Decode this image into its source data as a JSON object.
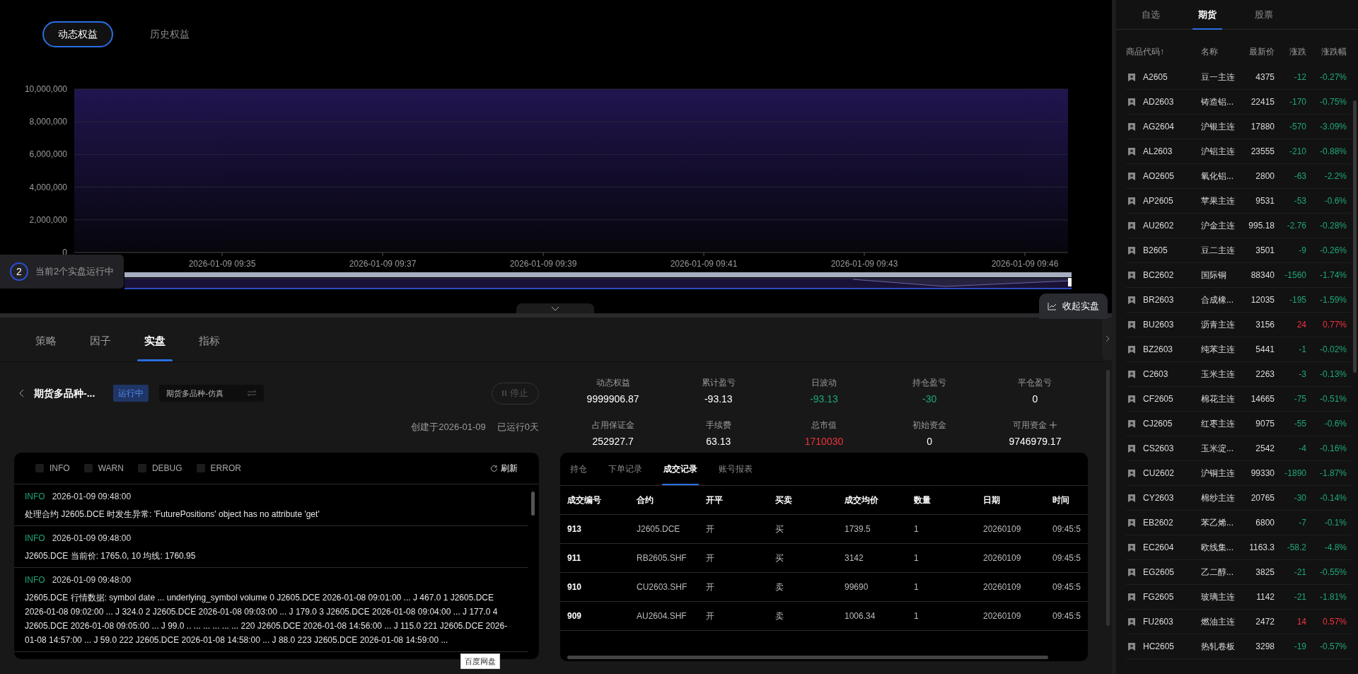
{
  "chart_tabs": [
    {
      "label": "动态权益",
      "selected": true
    },
    {
      "label": "历史权益",
      "selected": false
    }
  ],
  "equity_chart": {
    "chart_data": {
      "type": "area",
      "categories": [
        "2026-01-09 09:35",
        "2026-01-09 09:37",
        "2026-01-09 09:39",
        "2026-01-09 09:41",
        "2026-01-09 09:43",
        "2026-01-09 09:46"
      ],
      "grid": true,
      "series": [
        {
          "color": "#4a2fb0",
          "values": [
            10000000,
            10000000,
            10000000,
            10000000,
            10000000,
            10000000
          ]
        }
      ],
      "ylim": [
        0,
        10000000
      ],
      "yticks": [
        {
          "value": 0,
          "label": "0"
        },
        {
          "value": 2000000,
          "label": "2,000,000"
        },
        {
          "value": 4000000,
          "label": "4,000,000"
        },
        {
          "value": 6000000,
          "label": "6,000,000"
        },
        {
          "value": 8000000,
          "label": "8,000,000"
        },
        {
          "value": 10000000,
          "label": "10,000,000"
        }
      ]
    }
  },
  "zoom_slider": {
    "level": 1
  },
  "running_badge": {
    "count": "2",
    "label": "当前2个实盘运行中"
  },
  "collapse_button": "收起实盘",
  "bottom_tabs": [
    {
      "label": "策略",
      "selected": false
    },
    {
      "label": "因子",
      "selected": false
    },
    {
      "label": "实盘",
      "selected": true
    },
    {
      "label": "指标",
      "selected": false
    }
  ],
  "strategy": {
    "name": "期货多品种-...",
    "status": "运行中",
    "account": "期货多品种-仿真",
    "stop_button": {
      "label": "停止",
      "disabled": true
    },
    "created": "创建于2026-01-09",
    "running_days": "已运行0天"
  },
  "metrics": [
    {
      "label": "动态权益",
      "value": "9999906.87",
      "color": "#ffffff",
      "addable": false
    },
    {
      "label": "累计盈亏",
      "value": "-93.13",
      "color": "#ffffff",
      "addable": false
    },
    {
      "label": "日波动",
      "value": "-93.13",
      "color": "#1fa67a",
      "addable": false
    },
    {
      "label": "持仓盈亏",
      "value": "-30",
      "color": "#1fa67a",
      "addable": false
    },
    {
      "label": "平仓盈亏",
      "value": "0",
      "color": "#ffffff",
      "addable": false
    },
    {
      "label": "占用保证金",
      "value": "252927.7",
      "color": "#ffffff",
      "addable": false
    },
    {
      "label": "手续费",
      "value": "63.13",
      "color": "#ffffff",
      "addable": false
    },
    {
      "label": "总市值",
      "value": "1710030",
      "color": "#f2323f",
      "addable": false
    },
    {
      "label": "初始资金",
      "value": "0",
      "color": "#ffffff",
      "addable": false
    },
    {
      "label": "可用资金",
      "value": "9746979.17",
      "color": "#ffffff",
      "addable": true
    }
  ],
  "log": {
    "filters": [
      {
        "label": "INFO",
        "checked": false
      },
      {
        "label": "WARN",
        "checked": false
      },
      {
        "label": "DEBUG",
        "checked": false
      },
      {
        "label": "ERROR",
        "checked": false
      }
    ],
    "refresh": "刷新",
    "entries": [
      {
        "level": "INFO",
        "time": "2026-01-09 09:48:00",
        "message": "处理合约 J2605.DCE 时发生异常: 'FuturePositions' object has no attribute 'get'"
      },
      {
        "level": "INFO",
        "time": "2026-01-09 09:48:00",
        "message": "J2605.DCE 当前价: 1765.0, 10 均线: 1760.95"
      },
      {
        "level": "INFO",
        "time": "2026-01-09 09:48:00",
        "message": "J2605.DCE 行情数据: symbol date ... underlying_symbol volume 0 J2605.DCE 2026-01-08 09:01:00 ... J 467.0 1 J2605.DCE 2026-01-08 09:02:00 ... J 324.0 2 J2605.DCE 2026-01-08 09:03:00 ... J 179.0 3 J2605.DCE 2026-01-08 09:04:00 ... J 177.0 4 J2605.DCE 2026-01-08 09:05:00 ... J 99.0 .. ... ... ... ... ... 220 J2605.DCE 2026-01-08 14:56:00 ... J 115.0 221 J2605.DCE 2026-01-08 14:57:00 ... J 59.0 222 J2605.DCE 2026-01-08 14:58:00 ... J 88.0 223 J2605.DCE 2026-01-08 14:59:00 ..."
      }
    ]
  },
  "tooltip": "百度网盘",
  "trades": {
    "tabs": [
      {
        "label": "持仓",
        "selected": false
      },
      {
        "label": "下单记录",
        "selected": false
      },
      {
        "label": "成交记录",
        "selected": true
      },
      {
        "label": "账号报表",
        "selected": false
      }
    ],
    "columns": [
      "成交编号",
      "合约",
      "开平",
      "买卖",
      "成交均价",
      "数量",
      "日期",
      "时间"
    ],
    "rows": [
      [
        "913",
        "J2605.DCE",
        "开",
        "买",
        "1739.5",
        "1",
        "20260109",
        "09:45:5"
      ],
      [
        "911",
        "RB2605.SHF",
        "开",
        "买",
        "3142",
        "1",
        "20260109",
        "09:45:5"
      ],
      [
        "910",
        "CU2603.SHF",
        "开",
        "卖",
        "99690",
        "1",
        "20260109",
        "09:45:5"
      ],
      [
        "909",
        "AU2604.SHF",
        "开",
        "卖",
        "1006.34",
        "1",
        "20260109",
        "09:45:5"
      ]
    ]
  },
  "quotes": {
    "tabs": [
      {
        "label": "自选",
        "selected": false
      },
      {
        "label": "期货",
        "selected": true
      },
      {
        "label": "股票",
        "selected": false
      }
    ],
    "columns": [
      "商品代码↑",
      "名称",
      "最新价",
      "涨跌",
      "涨跌幅"
    ],
    "rows": [
      {
        "code": "A2605",
        "name": "豆一主连",
        "price": "4375",
        "change": "-12",
        "pct": "-0.27%",
        "color": "#1fa67a"
      },
      {
        "code": "AD2603",
        "name": "铸造铝...",
        "price": "22415",
        "change": "-170",
        "pct": "-0.75%",
        "color": "#1fa67a"
      },
      {
        "code": "AG2604",
        "name": "沪银主连",
        "price": "17880",
        "change": "-570",
        "pct": "-3.09%",
        "color": "#1fa67a"
      },
      {
        "code": "AL2603",
        "name": "沪铝主连",
        "price": "23555",
        "change": "-210",
        "pct": "-0.88%",
        "color": "#1fa67a"
      },
      {
        "code": "AO2605",
        "name": "氧化铝...",
        "price": "2800",
        "change": "-63",
        "pct": "-2.2%",
        "color": "#1fa67a"
      },
      {
        "code": "AP2605",
        "name": "苹果主连",
        "price": "9531",
        "change": "-53",
        "pct": "-0.6%",
        "color": "#1fa67a"
      },
      {
        "code": "AU2602",
        "name": "沪金主连",
        "price": "995.18",
        "change": "-2.76",
        "pct": "-0.28%",
        "color": "#1fa67a"
      },
      {
        "code": "B2605",
        "name": "豆二主连",
        "price": "3501",
        "change": "-9",
        "pct": "-0.26%",
        "color": "#1fa67a"
      },
      {
        "code": "BC2602",
        "name": "国际铜",
        "price": "88340",
        "change": "-1560",
        "pct": "-1.74%",
        "color": "#1fa67a"
      },
      {
        "code": "BR2603",
        "name": "合成橡...",
        "price": "12035",
        "change": "-195",
        "pct": "-1.59%",
        "color": "#1fa67a"
      },
      {
        "code": "BU2603",
        "name": "沥青主连",
        "price": "3156",
        "change": "24",
        "pct": "0.77%",
        "color": "#f2323f"
      },
      {
        "code": "BZ2603",
        "name": "纯苯主连",
        "price": "5441",
        "change": "-1",
        "pct": "-0.02%",
        "color": "#1fa67a"
      },
      {
        "code": "C2603",
        "name": "玉米主连",
        "price": "2263",
        "change": "-3",
        "pct": "-0.13%",
        "color": "#1fa67a"
      },
      {
        "code": "CF2605",
        "name": "棉花主连",
        "price": "14665",
        "change": "-75",
        "pct": "-0.51%",
        "color": "#1fa67a"
      },
      {
        "code": "CJ2605",
        "name": "红枣主连",
        "price": "9075",
        "change": "-55",
        "pct": "-0.6%",
        "color": "#1fa67a"
      },
      {
        "code": "CS2603",
        "name": "玉米淀...",
        "price": "2542",
        "change": "-4",
        "pct": "-0.16%",
        "color": "#1fa67a"
      },
      {
        "code": "CU2602",
        "name": "沪铜主连",
        "price": "99330",
        "change": "-1890",
        "pct": "-1.87%",
        "color": "#1fa67a"
      },
      {
        "code": "CY2603",
        "name": "棉纱主连",
        "price": "20765",
        "change": "-30",
        "pct": "-0.14%",
        "color": "#1fa67a"
      },
      {
        "code": "EB2602",
        "name": "苯乙烯...",
        "price": "6800",
        "change": "-7",
        "pct": "-0.1%",
        "color": "#1fa67a"
      },
      {
        "code": "EC2604",
        "name": "欧线集...",
        "price": "1163.3",
        "change": "-58.2",
        "pct": "-4.8%",
        "color": "#1fa67a"
      },
      {
        "code": "EG2605",
        "name": "乙二醇...",
        "price": "3825",
        "change": "-21",
        "pct": "-0.55%",
        "color": "#1fa67a"
      },
      {
        "code": "FG2605",
        "name": "玻璃主连",
        "price": "1142",
        "change": "-21",
        "pct": "-1.81%",
        "color": "#1fa67a"
      },
      {
        "code": "FU2603",
        "name": "燃油主连",
        "price": "2472",
        "change": "14",
        "pct": "0.57%",
        "color": "#f2323f"
      },
      {
        "code": "HC2605",
        "name": "热轧卷板",
        "price": "3298",
        "change": "-19",
        "pct": "-0.57%",
        "color": "#1fa67a"
      }
    ]
  }
}
